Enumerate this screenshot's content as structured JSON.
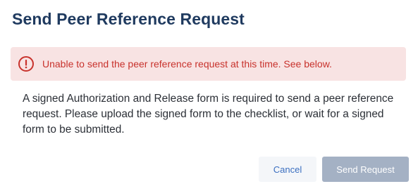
{
  "dialog": {
    "title": "Send Peer Reference Request",
    "error": {
      "icon": "alert-circle-icon",
      "message": "Unable to send the peer reference request at this time. See below.",
      "color": "#c8322c",
      "background": "#f8e3e3"
    },
    "body": "A signed Authorization and Release form is required to send a peer reference request. Please upload the signed form to the checklist, or wait for a signed form to be submitted.",
    "buttons": {
      "cancel_label": "Cancel",
      "send_label": "Send Request",
      "send_disabled": true
    },
    "colors": {
      "title": "#1f3a5f",
      "link": "#3b6fc0",
      "disabled_button": "#a4b1c4"
    }
  }
}
